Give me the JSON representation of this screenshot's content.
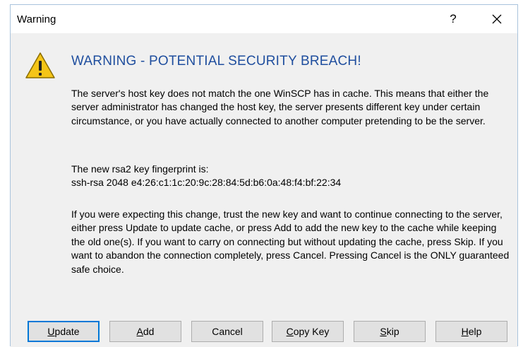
{
  "window": {
    "title": "Warning",
    "help_label": "?"
  },
  "message": {
    "heading": "WARNING - POTENTIAL SECURITY BREACH!",
    "paragraph1": "The server's host key does not match the one WinSCP has in cache. This means that either the server administrator has changed the host key, the server presents different key under certain circumstance, or you have actually connected to another computer pretending to be the server.",
    "fingerprint_label": "The new rsa2 key fingerprint is:",
    "fingerprint_value": "ssh-rsa 2048 e4:26:c1:1c:20:9c:28:84:5d:b6:0a:48:f4:bf:22:34",
    "paragraph3": "If you were expecting this change, trust the new key and want to continue connecting to the server, either press Update to update cache, or press Add to add the new key to the cache while keeping the old one(s). If you want to carry on connecting but without updating the cache, press Skip. If you want to abandon the connection completely, press Cancel. Pressing Cancel is the ONLY guaranteed safe choice."
  },
  "buttons": {
    "update": {
      "mnemonic": "U",
      "rest": "pdate"
    },
    "add": {
      "mnemonic": "A",
      "rest": "dd"
    },
    "cancel": {
      "label": "Cancel"
    },
    "copy_key": {
      "mnemonic": "C",
      "rest": "opy Key"
    },
    "skip": {
      "mnemonic": "S",
      "rest": "kip"
    },
    "help": {
      "mnemonic": "H",
      "rest": "elp"
    }
  },
  "icons": {
    "warning": "warning-triangle-icon",
    "close": "close-icon"
  },
  "colors": {
    "heading": "#1f4e9e",
    "warning_fill": "#f5c518",
    "default_button_border": "#0078d7"
  }
}
